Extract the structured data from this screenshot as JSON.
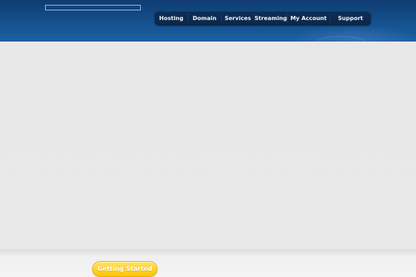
{
  "header": {
    "logo": "",
    "nav": [
      {
        "label": "Hosting"
      },
      {
        "label": "Domain"
      },
      {
        "label": "Services"
      },
      {
        "label": "Streaming"
      },
      {
        "label": "My Account"
      },
      {
        "label": "Support"
      }
    ]
  },
  "main": {
    "cta_label": "Getting Started"
  },
  "colors": {
    "header_dark": "#0f3b72",
    "header_light": "#1d5fa1",
    "nav_bg": "#0b2748",
    "content_bg": "#e8e8e8",
    "cta_yellow": "#ffd431"
  },
  "icons": {
    "logo_placeholder": "logo-placeholder-icon"
  }
}
